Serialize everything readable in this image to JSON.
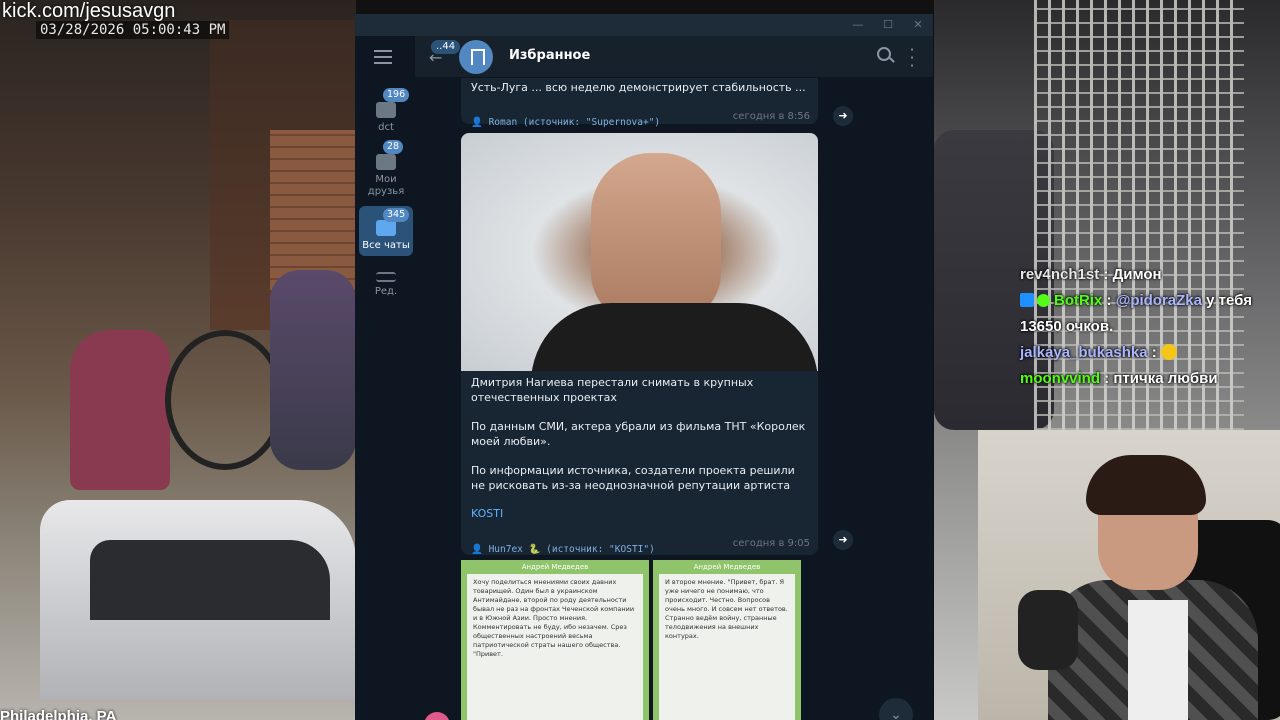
{
  "overlay": {
    "stream_url": "kick.com/jesusavgn",
    "timestamp": "03/28/2026 05:00:43 PM",
    "location": "Philadelphia, PA"
  },
  "chat": [
    {
      "user": "rev4nch1st",
      "text": "Димон"
    },
    {
      "user": "BotRix",
      "mention": "@pidoraZka",
      "text": "у тебя 13650 очков."
    },
    {
      "user": "jalkaya_bukashka",
      "emoji": "emoji-face"
    },
    {
      "user": "moonvvind",
      "text": "птичка любви"
    }
  ],
  "telegram": {
    "window_controls": [
      "—",
      "☐",
      "✕"
    ],
    "rail": {
      "menu_icon": "hamburger-icon",
      "folders": [
        {
          "label": "dct",
          "badge": "196"
        },
        {
          "label": "Мои друзья",
          "badge": "28"
        },
        {
          "label": "Все чаты",
          "badge": "345",
          "active": true
        },
        {
          "label": "Ред.",
          "badge": ""
        }
      ]
    },
    "header": {
      "back_badge": "44",
      "title": "Избранное"
    },
    "messages": [
      {
        "text": "Усть-Луга ... всю неделю демонстрирует стабильность  ...",
        "forwarded_from": "Roman (источник: \"Supernova+\")",
        "time": "сегодня в 8:56"
      },
      {
        "paragraphs": [
          "Дмитрия Нагиева перестали снимать в крупных отечественных проектах",
          "По данным СМИ, актера убрали из фильма ТНТ «Королек моей любви».",
          "По информации источника, создатели проекта решили не рисковать из-за неоднозначной репутации артиста"
        ],
        "link": "KOSTI",
        "forwarded_from": "Hun7ex 🐍 (источник: \"KOSTI\")",
        "time": "сегодня в 9:05"
      },
      {
        "thumb1_title": "Андрей Медведев",
        "thumb1_text": "Хочу поделиться мнениями своих давних товарищей. Один был в украинском Антимайдане, второй по роду деятельности бывал не раз на фронтах Чеченской компании и в Южной Азии. Просто мнения. Комментировать не буду, ибо незачем. Срез общественных настроений весьма патриотической страты нашего общества. \"Привет.",
        "thumb2_title": "Андрей Медведев",
        "thumb2_text": "И второе мнение. \"Привет, брат. Я уже ничего не понимаю, что происходит. Честно. Вопросов очень много. И совсем нет ответов. Странно ведём войну, странные телодвижения на внешних контурах."
      }
    ]
  }
}
